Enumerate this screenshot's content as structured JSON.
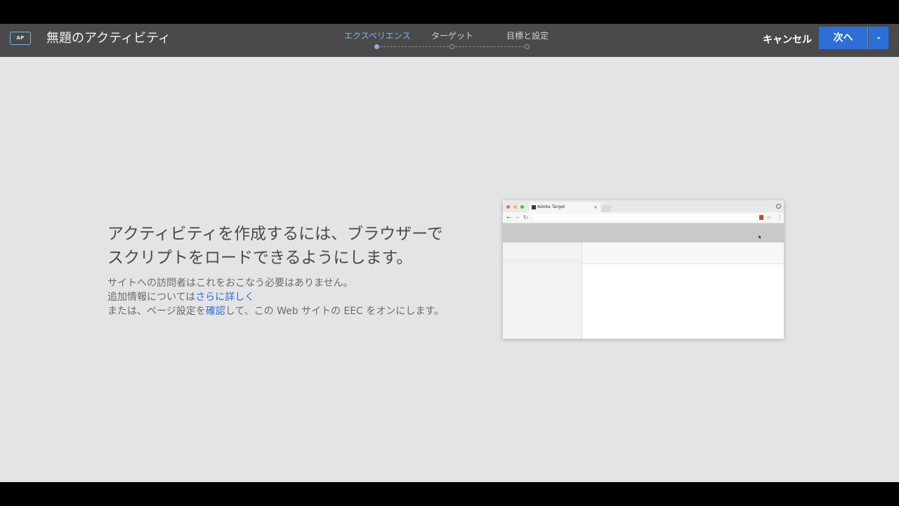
{
  "header": {
    "app_badge": "AP",
    "activity_title": "無題のアクティビティ",
    "steps": [
      {
        "label": "エクスペリエンス",
        "active": true
      },
      {
        "label": "ターゲット",
        "active": false
      },
      {
        "label": "目標と設定",
        "active": false
      }
    ],
    "cancel_label": "キャンセル",
    "next_label": "次へ"
  },
  "main": {
    "headline_line1": "アクティビティを作成するには、ブラウザーで",
    "headline_line2": "スクリプトをロードできるようにします。",
    "desc_line1": "サイトへの訪問者はこれをおこなう必要はありません。",
    "desc_line2_prefix": "追加情報については",
    "desc_line2_link": "さらに詳しく",
    "desc_line3_prefix": "または、ページ設定を",
    "desc_line3_link": "確認",
    "desc_line3_suffix": "して、この Web サイトの EEC をオンにします。"
  },
  "illustration": {
    "tab_title": "Adobe Target",
    "tab_close": "×"
  },
  "colors": {
    "accent": "#2d6fd6",
    "active_step": "#7ab6ef",
    "topbar": "#4a4a4a",
    "background": "#e4e4e6"
  }
}
